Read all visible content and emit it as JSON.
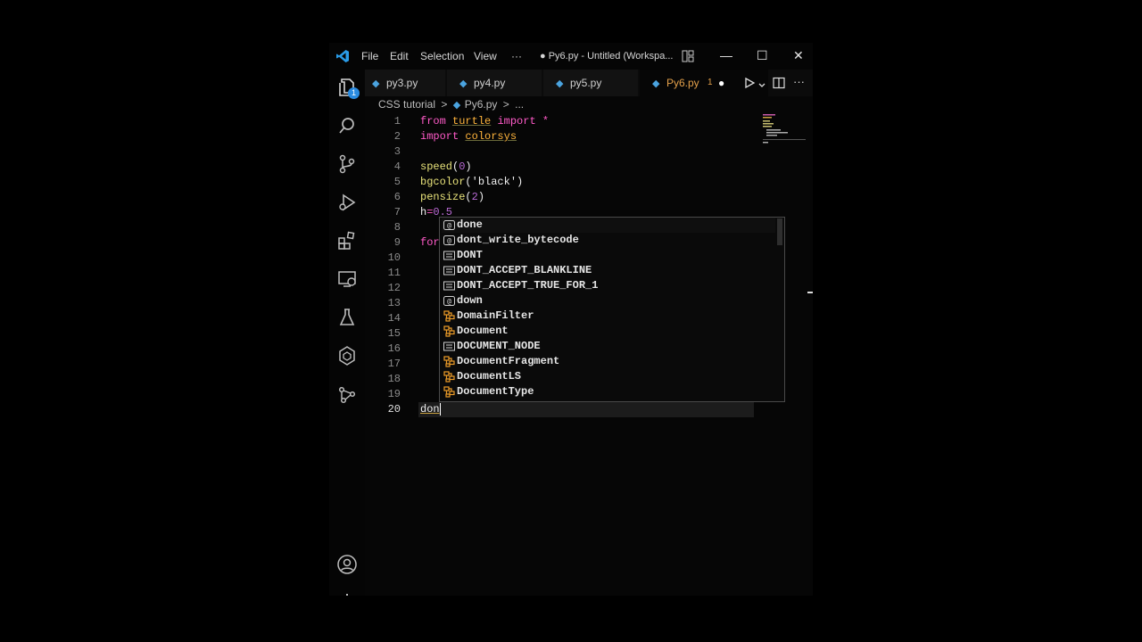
{
  "titlebar": {
    "menus": [
      "File",
      "Edit",
      "Selection",
      "View",
      "···"
    ],
    "title": "● Py6.py - Untitled (Workspa...",
    "minimize": "—",
    "maximize": "☐",
    "close": "✕"
  },
  "activity": {
    "explorer_badge": "1"
  },
  "tabs": [
    {
      "label": "py3.py"
    },
    {
      "label": "py4.py"
    },
    {
      "label": "py5.py"
    },
    {
      "label": "Py6.py",
      "problems": "1",
      "dirty": "●"
    }
  ],
  "breadcrumb": {
    "folder": "CSS tutorial",
    "sep": ">",
    "file": "Py6.py",
    "sep2": ">",
    "tail": "..."
  },
  "editor": {
    "line_numbers": [
      "1",
      "2",
      "3",
      "4",
      "5",
      "6",
      "7",
      "8",
      "9",
      "10",
      "11",
      "12",
      "13",
      "14",
      "15",
      "16",
      "17",
      "18",
      "19",
      "20"
    ],
    "lines": {
      "l1": {
        "kw1": "from",
        "mod": "turtle",
        "kw2": "import",
        "star": "*"
      },
      "l2": {
        "kw": "import",
        "mod": "colorsys"
      },
      "l4": {
        "fn": "speed",
        "open": "(",
        "num": "0",
        "close": ")"
      },
      "l5": {
        "fn": "bgcolor",
        "open": "(",
        "str": "'black'",
        "close": ")"
      },
      "l6": {
        "fn": "pensize",
        "open": "(",
        "num": "2",
        "close": ")"
      },
      "l7": {
        "var": "h",
        "eq": "=",
        "num": "0.5"
      },
      "l9": {
        "kw": "for"
      },
      "l20": {
        "text": "don"
      }
    }
  },
  "suggestions": [
    {
      "label": "done",
      "kind": "function"
    },
    {
      "label": "dont_write_bytecode",
      "kind": "function"
    },
    {
      "label": "DONT",
      "kind": "constant"
    },
    {
      "label": "DONT_ACCEPT_BLANKLINE",
      "kind": "constant"
    },
    {
      "label": "DONT_ACCEPT_TRUE_FOR_1",
      "kind": "constant"
    },
    {
      "label": "down",
      "kind": "function"
    },
    {
      "label": "DomainFilter",
      "kind": "class"
    },
    {
      "label": "Document",
      "kind": "class"
    },
    {
      "label": "DOCUMENT_NODE",
      "kind": "constant"
    },
    {
      "label": "DocumentFragment",
      "kind": "class"
    },
    {
      "label": "DocumentLS",
      "kind": "class"
    },
    {
      "label": "DocumentType",
      "kind": "class"
    }
  ],
  "colors": {
    "keyword": "#ff5ac8",
    "function": "#e8e27a",
    "module": "#ffb43c",
    "number": "#b86ad4",
    "class_icon": "#ee9d28",
    "tab_active": "#e3a04a"
  }
}
